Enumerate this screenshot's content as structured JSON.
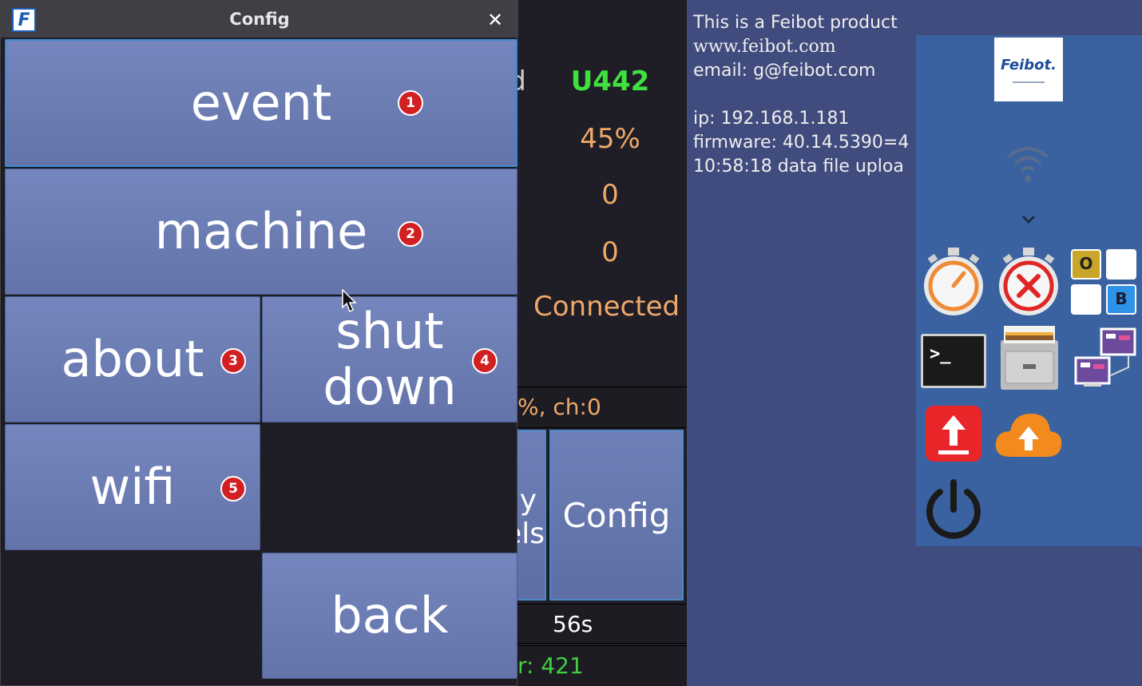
{
  "window": {
    "title": "Config",
    "app_logo_letter": "F",
    "close_glyph": "✕"
  },
  "buttons": {
    "event": "event",
    "machine": "machine",
    "about": "about",
    "shutdown_line1": "shut",
    "shutdown_line2": "down",
    "wifi": "wifi",
    "back": "back"
  },
  "badges": [
    "1",
    "2",
    "3",
    "4",
    "5"
  ],
  "background_app": {
    "label_fragment": "d",
    "device_id": "U442",
    "percent": "45%",
    "count_a": "0",
    "count_b": "0",
    "status": "Connected",
    "channel_text": "%, ch:0",
    "partial_btn_line1": "y",
    "partial_btn_line2": "els",
    "config_button": "Config",
    "timer": "56s",
    "counter_text": "r: 421",
    "colors": {
      "device_id": "#3fe13f",
      "values": "#f0a868",
      "counter": "#3fcf3f"
    }
  },
  "desktop": {
    "info_lines": [
      "This is a Feibot product",
      "www.feibot.com",
      "email: g@feibot.com",
      "",
      "ip: 192.168.1.181",
      "firmware: 40.14.5390=4",
      "10:58:18 data file uploa"
    ],
    "brand_name": "Feibot.",
    "keys": {
      "o": "O",
      "b": "B"
    },
    "terminal_prompt": ">_",
    "icons": [
      "wifi-icon",
      "chevron-down-icon",
      "stopwatch-icon",
      "stopwatch-cancel-icon",
      "keyboard-keys-icon",
      "terminal-icon",
      "file-cabinet-icon",
      "network-icon",
      "upload-icon",
      "cloud-upload-icon",
      "power-icon"
    ]
  }
}
